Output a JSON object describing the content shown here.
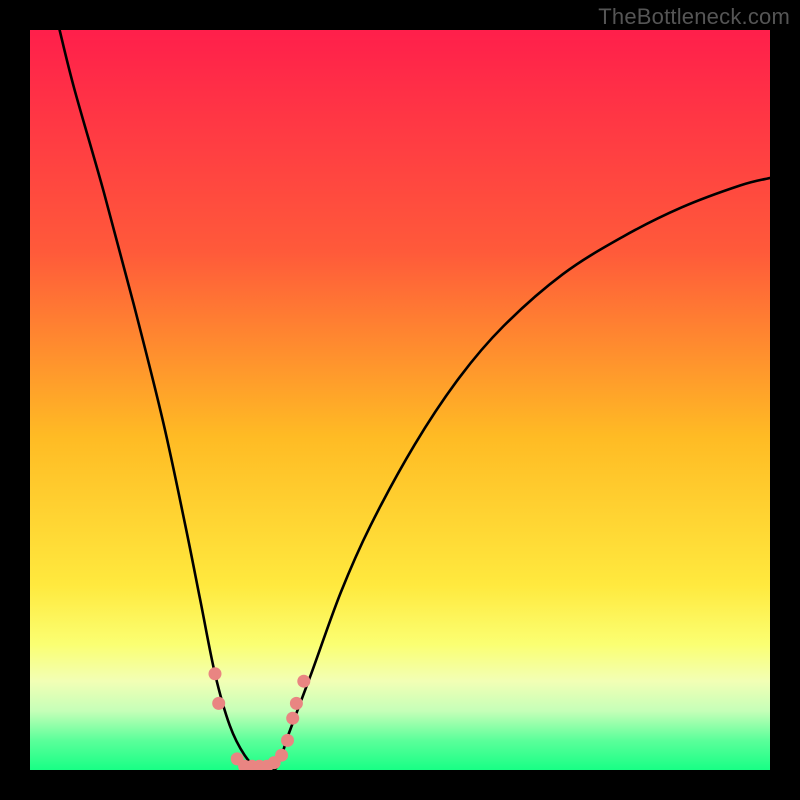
{
  "watermark": "TheBottleneck.com",
  "chart_data": {
    "type": "line",
    "title": "",
    "xlabel": "",
    "ylabel": "",
    "xlim": [
      0,
      100
    ],
    "ylim": [
      0,
      100
    ],
    "grid": false,
    "legend": null,
    "gradient_stops": [
      {
        "offset": 0,
        "color": "#ff1f4b"
      },
      {
        "offset": 0.3,
        "color": "#ff5a3a"
      },
      {
        "offset": 0.55,
        "color": "#ffbb24"
      },
      {
        "offset": 0.75,
        "color": "#ffe93e"
      },
      {
        "offset": 0.83,
        "color": "#fbff72"
      },
      {
        "offset": 0.88,
        "color": "#f2ffb5"
      },
      {
        "offset": 0.92,
        "color": "#c6ffb8"
      },
      {
        "offset": 0.96,
        "color": "#5bff9a"
      },
      {
        "offset": 1.0,
        "color": "#18ff85"
      }
    ],
    "series": [
      {
        "name": "bottleneck-curve",
        "x": [
          4,
          6,
          10,
          14,
          18,
          21,
          23,
          25,
          27,
          29,
          31,
          33,
          34,
          35,
          38,
          42,
          46,
          52,
          58,
          64,
          72,
          80,
          88,
          96,
          100
        ],
        "y": [
          100,
          92,
          78,
          63,
          47,
          33,
          23,
          13,
          6,
          2,
          0,
          0,
          2,
          5,
          13,
          24,
          33,
          44,
          53,
          60,
          67,
          72,
          76,
          79,
          80
        ]
      }
    ],
    "markers": {
      "name": "highlight-dots",
      "color": "#e98582",
      "points": [
        {
          "x": 25,
          "y": 13
        },
        {
          "x": 25.5,
          "y": 9
        },
        {
          "x": 28,
          "y": 1.5
        },
        {
          "x": 29,
          "y": 0.5
        },
        {
          "x": 30,
          "y": 0.5
        },
        {
          "x": 31,
          "y": 0.5
        },
        {
          "x": 32,
          "y": 0.5
        },
        {
          "x": 33,
          "y": 1
        },
        {
          "x": 34,
          "y": 2
        },
        {
          "x": 34.8,
          "y": 4
        },
        {
          "x": 35.5,
          "y": 7
        },
        {
          "x": 36,
          "y": 9
        },
        {
          "x": 37,
          "y": 12
        }
      ]
    }
  }
}
